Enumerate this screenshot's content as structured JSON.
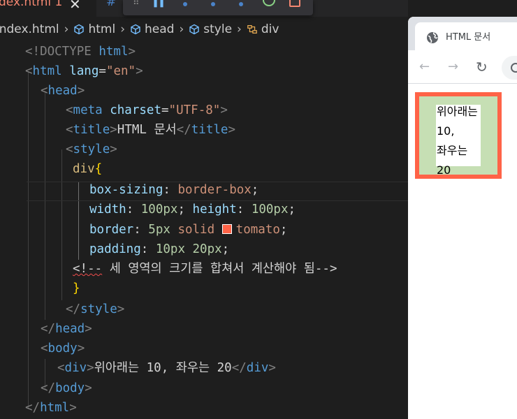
{
  "editor": {
    "tabs": [
      {
        "label": "dex.html 1",
        "close": "✕"
      },
      {
        "label": "#"
      }
    ],
    "breadcrumb": [
      "index.html",
      "html",
      "head",
      "style",
      "div"
    ],
    "lines": [
      [
        "<!DOCTYPE",
        " html",
        ">"
      ],
      [
        "<",
        "html",
        " lang",
        "=",
        "\"en\"",
        ">"
      ],
      [
        "<",
        "head",
        ">"
      ],
      [
        "<",
        "meta",
        " charset",
        "=",
        "\"UTF-8\"",
        ">"
      ],
      [
        "<",
        "title",
        ">",
        "HTML 문서",
        "</",
        "title",
        ">"
      ],
      [
        "<",
        "style",
        ">"
      ],
      [
        "div",
        "{"
      ],
      [
        "box-sizing",
        ": ",
        "border-box",
        ";"
      ],
      [
        "width",
        ": ",
        "100px",
        "; ",
        "height",
        ": ",
        "100px",
        ";"
      ],
      [
        "border",
        ": ",
        "5px",
        " solid ",
        "tomato",
        ";"
      ],
      [
        "padding",
        ": ",
        "10px 20px",
        ";"
      ],
      [
        "<!--",
        " 세 영역의 크기를 합쳐서 계산해야 됨-->"
      ],
      [
        "}"
      ],
      [
        "</",
        "style",
        ">"
      ],
      [
        "</",
        "head",
        ">"
      ],
      [
        "<",
        "body",
        ">"
      ],
      [
        "<",
        "div",
        ">",
        "위아래는 10, 좌우는 20",
        "</",
        "div",
        ">"
      ],
      [
        "</",
        "body",
        ">"
      ],
      [
        "</",
        "html",
        ">"
      ]
    ]
  },
  "browser": {
    "tab_title": "HTML 문서",
    "nav": {
      "back": "←",
      "forward": "→",
      "reload": "↻"
    },
    "demo_text": "위아래는 10, 좌우는 20"
  },
  "colors": {
    "tomato": "#ff6347",
    "padding_green": "#c6dfb4"
  }
}
